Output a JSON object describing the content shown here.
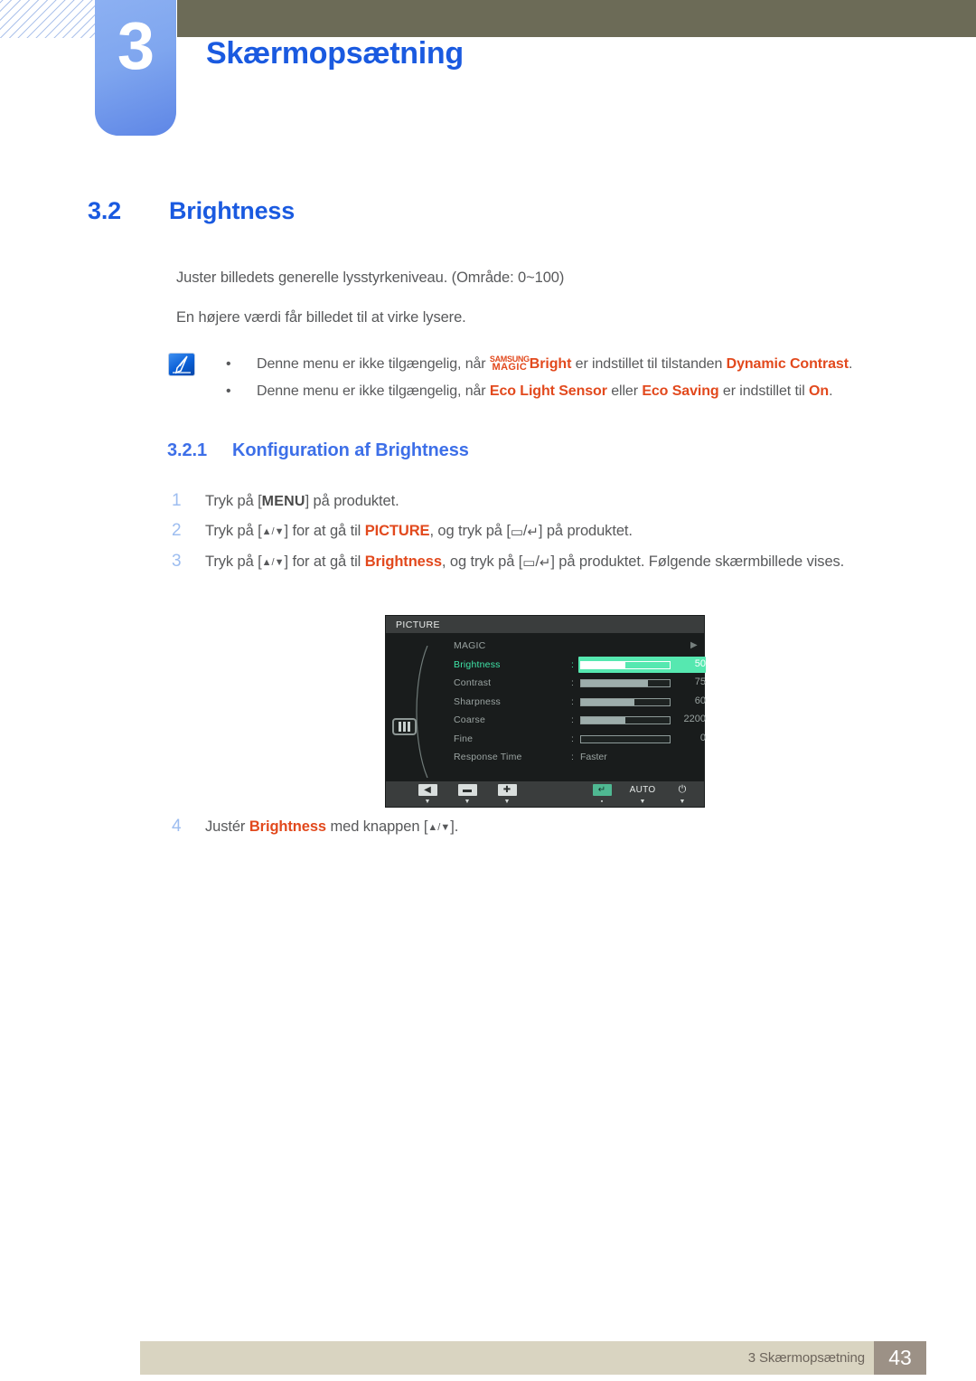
{
  "header": {
    "chapter_number": "3",
    "chapter_title": "Skærmopsætning"
  },
  "section": {
    "number": "3.2",
    "title": "Brightness"
  },
  "paragraphs": {
    "p1": "Juster billedets generelle lysstyrkeniveau. (Område: 0~100)",
    "p2": "En højere værdi får billedet til at virke lysere."
  },
  "note": {
    "bullet_glyph": "•",
    "item1": {
      "pre": "Denne menu er ikke tilgængelig, når ",
      "magic_line1": "SAMSUNG",
      "magic_line2": "MAGIC",
      "bright": "Bright",
      "mid": " er indstillet til tilstanden ",
      "highlight": "Dynamic Contrast",
      "post": "."
    },
    "item2": {
      "pre": "Denne menu er ikke tilgængelig, når ",
      "hl1": "Eco Light Sensor",
      "mid1": " eller ",
      "hl2": "Eco Saving",
      "mid2": " er indstillet til ",
      "hl3": "On",
      "post": "."
    }
  },
  "subsection": {
    "number": "3.2.1",
    "title": "Konfiguration af Brightness"
  },
  "steps": [
    {
      "num": "1",
      "pre": "Tryk på [",
      "key": "MENU",
      "post": "] på produktet."
    },
    {
      "num": "2",
      "pre": "Tryk på [",
      "arrows": "▲/▼",
      "mid1": "] for at gå til ",
      "target": "PICTURE",
      "mid2": ", og tryk på [",
      "glyph1": "▭",
      "slash": "/",
      "glyph2": "↵",
      "post": "] på produktet."
    },
    {
      "num": "3",
      "pre": "Tryk på [",
      "arrows": "▲/▼",
      "mid1": "] for at gå til ",
      "target": "Brightness",
      "mid2": ", og tryk på [",
      "glyph1": "▭",
      "slash": "/",
      "glyph2": "↵",
      "post": "] på produktet. Følgende skærmbillede vises."
    },
    {
      "num": "4",
      "pre": "Justér ",
      "target": "Brightness",
      "mid1": " med knappen [",
      "arrows": "▲/▼",
      "post": "]."
    }
  ],
  "osd": {
    "title": "PICTURE",
    "left_icon": "brightness-icon",
    "rows": [
      {
        "label": "MAGIC",
        "kind": "submenu",
        "arrow": "▶"
      },
      {
        "label": "Brightness",
        "kind": "slider",
        "value": "50",
        "percent": 50,
        "selected": true
      },
      {
        "label": "Contrast",
        "kind": "slider",
        "value": "75",
        "percent": 75,
        "selected": false
      },
      {
        "label": "Sharpness",
        "kind": "slider",
        "value": "60",
        "percent": 60,
        "selected": false
      },
      {
        "label": "Coarse",
        "kind": "slider",
        "value": "2200",
        "percent": 50,
        "selected": false
      },
      {
        "label": "Fine",
        "kind": "slider",
        "value": "0",
        "percent": 0,
        "selected": false
      },
      {
        "label": "Response Time",
        "kind": "text",
        "value": "Faster",
        "selected": false
      }
    ],
    "toolbar": [
      {
        "name": "back",
        "glyph": "◀",
        "caret": "▼"
      },
      {
        "name": "minus",
        "glyph": "▬",
        "caret": "▼"
      },
      {
        "name": "plus",
        "glyph": "✚",
        "caret": "▼"
      },
      {
        "name": "enter",
        "glyph": "↵",
        "caret": "▪"
      },
      {
        "name": "auto",
        "glyph": "AUTO",
        "caret": "▼"
      },
      {
        "name": "power",
        "glyph": "⏻",
        "caret": "▼"
      }
    ]
  },
  "footer": {
    "text": "3 Skærmopsætning",
    "page": "43"
  },
  "colors": {
    "heading_blue": "#1a5ae0",
    "accent_orange": "#e2491d",
    "olive_bar": "#6c6b57",
    "footer_bg": "#d9d4c1",
    "page_box": "#9c9186",
    "osd_highlight": "#56e8b0"
  }
}
